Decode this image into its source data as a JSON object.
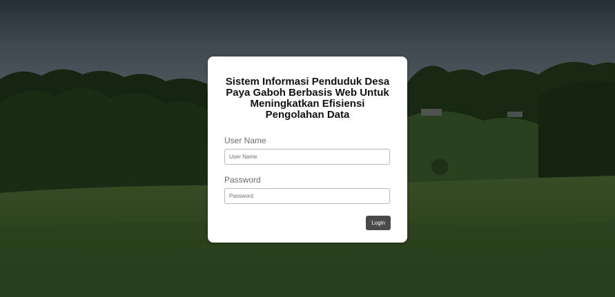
{
  "login_card": {
    "title": "Sistem Informasi Penduduk Desa Paya Gaboh Berbasis Web Untuk Meningkatkan Efisiensi Pengolahan Data",
    "username": {
      "label": "User Name",
      "placeholder": "User Name",
      "value": ""
    },
    "password": {
      "label": "Password",
      "placeholder": "Password",
      "value": ""
    },
    "login_label": "Login"
  },
  "colors": {
    "card_background": "#ffffff",
    "button_background": "#4a4a4a",
    "button_text": "#ffffff",
    "label_text": "#6b6b6b"
  }
}
